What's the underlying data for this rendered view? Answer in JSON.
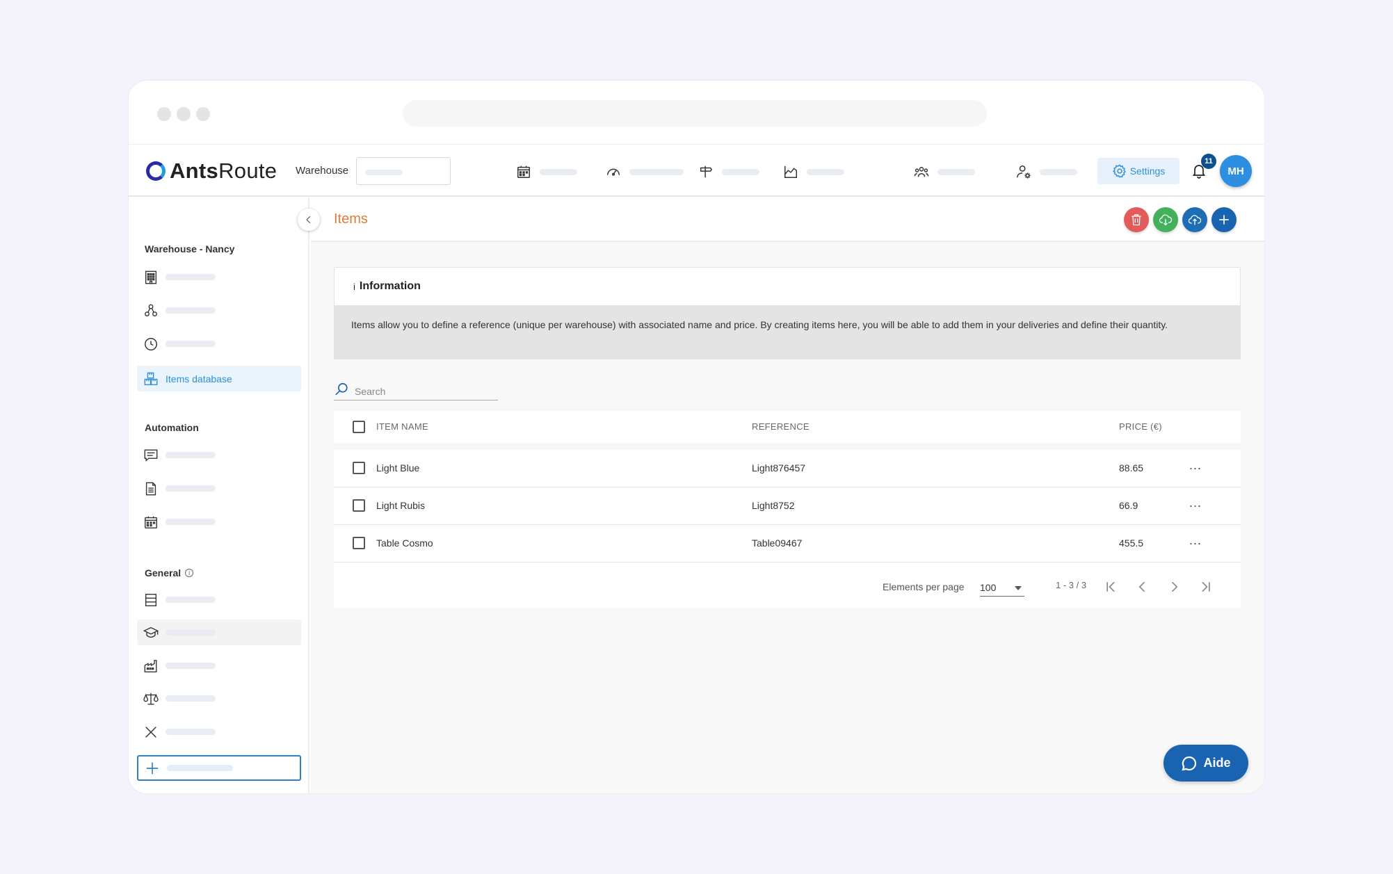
{
  "app": {
    "logo_bold": "Ants",
    "logo_light": "Route"
  },
  "topnav": {
    "warehouse_label": "Warehouse",
    "items": [
      {
        "icon": "calendar-icon"
      },
      {
        "icon": "speedometer-icon"
      },
      {
        "icon": "signpost-icon"
      },
      {
        "icon": "area-chart-icon"
      },
      {
        "icon": "team-icon"
      },
      {
        "icon": "user-settings-icon"
      }
    ],
    "settings_label": "Settings",
    "notifications_count": "11",
    "avatar_initials": "MH"
  },
  "sidebar": {
    "sections": [
      {
        "title": "Warehouse - Nancy"
      },
      {
        "title": "Automation"
      },
      {
        "title": "General",
        "info_icon": "i"
      }
    ],
    "active_item_label": "Items database"
  },
  "page": {
    "title": "Items",
    "info": {
      "icon": "i",
      "title": "Information",
      "body": "Items allow you to define a reference (unique per warehouse) with associated name and price. By creating items here, you will be able to add them in your deliveries and define their quantity."
    },
    "search_placeholder": "Search",
    "table": {
      "headers": {
        "name": "ITEM NAME",
        "reference": "REFERENCE",
        "price": "PRICE (€)"
      },
      "rows": [
        {
          "name": "Light Blue",
          "reference": "Light876457",
          "price": "88.65",
          "more": "..."
        },
        {
          "name": "Light Rubis",
          "reference": "Light8752",
          "price": "66.9",
          "more": "..."
        },
        {
          "name": "Table Cosmo",
          "reference": "Table09467",
          "price": "455.5",
          "more": "..."
        }
      ]
    },
    "pagination": {
      "label": "Elements per page",
      "per_page": "100",
      "range": "1 - 3 / 3"
    }
  },
  "help": {
    "label": "Aide"
  },
  "colors": {
    "accent": "#2f8fd6",
    "title_orange": "#e17b3c",
    "delete_red": "#e35a5a",
    "download_green": "#43b05c",
    "upload_blue": "#1f6eb5",
    "add_blue": "#1a63b1"
  }
}
